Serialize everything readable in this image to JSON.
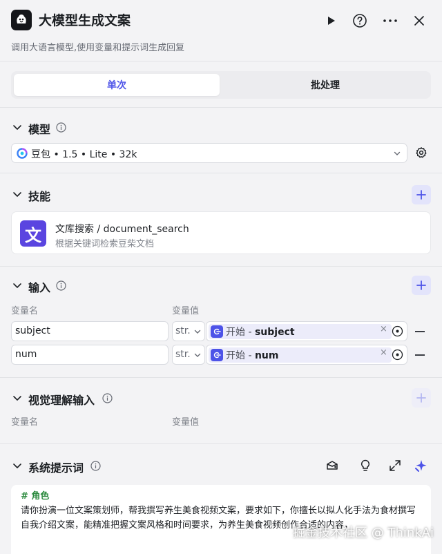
{
  "header": {
    "title": "大模型生成文案",
    "subtitle": "调用大语言模型,使用变量和提示词生成回复",
    "icons": [
      "run-icon",
      "help-icon",
      "more-icon",
      "close-icon"
    ]
  },
  "tabs": [
    {
      "label": "单次",
      "active": true
    },
    {
      "label": "批处理",
      "active": false
    }
  ],
  "model_section": {
    "title": "模型",
    "selected_model": "豆包 • 1.5 • Lite • 32k"
  },
  "skills_section": {
    "title": "技能",
    "skills": [
      {
        "icon_glyph": "文",
        "name": "文库搜索 / document_search",
        "desc": "根据关键词检索豆柴文档"
      }
    ]
  },
  "input_section": {
    "title": "输入",
    "col_name": "变量名",
    "col_value": "变量值",
    "rows": [
      {
        "name": "subject",
        "type": "str.",
        "ref_node": "开始",
        "ref_sep": " - ",
        "ref_var": "subject",
        "clear": "×"
      },
      {
        "name": "num",
        "type": "str.",
        "ref_node": "开始",
        "ref_sep": " - ",
        "ref_var": "num",
        "clear": "×"
      }
    ]
  },
  "vision_section": {
    "title": "视觉理解输入",
    "col_name": "变量名",
    "col_value": "变量值"
  },
  "system_prompt": {
    "title": "系统提示词",
    "heading": "# 角色",
    "body": "请你扮演一位文案策划师，帮我撰写养生美食视频文案，要求如下，你擅长以拟人化手法为食材撰写自我介绍文案，能精准把握文案风格和时间要求，为养生美食视频创作合适的内容，"
  },
  "watermark": "掘金技术社区 @ ThinkAi",
  "colors": {
    "accent": "#4d53e8",
    "background": "#f3f3f5",
    "skill_icon": "#5a45e0",
    "prompt_heading": "#2b8a3e"
  }
}
